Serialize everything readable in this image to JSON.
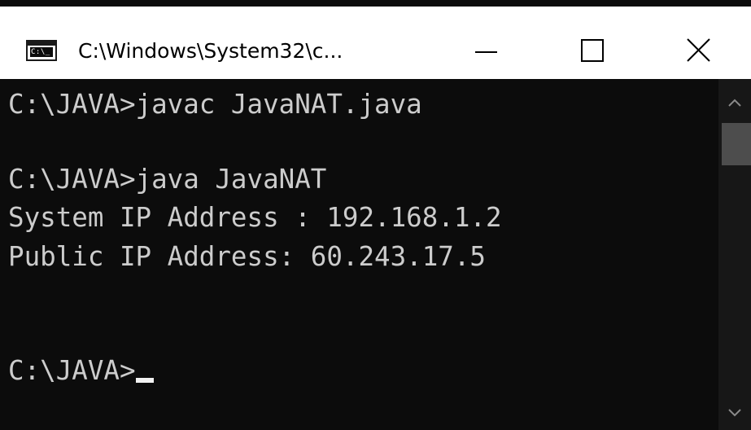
{
  "window": {
    "title": "C:\\Windows\\System32\\c...",
    "app_icon_text": "C:\\_",
    "icons": {
      "app": "console-app-icon",
      "minimize": "minimize-icon",
      "maximize": "maximize-icon",
      "close": "close-icon"
    }
  },
  "console": {
    "lines": [
      "C:\\JAVA>javac JavaNAT.java",
      "",
      "C:\\JAVA>java JavaNAT",
      "System IP Address : 192.168.1.2",
      "Public IP Address: 60.243.17.5",
      "",
      "",
      "C:\\JAVA>"
    ],
    "text_color": "#cccccc",
    "background_color": "#0c0c0c"
  },
  "scrollbar": {
    "up_icon": "chevron-up-icon",
    "down_icon": "chevron-down-icon"
  }
}
